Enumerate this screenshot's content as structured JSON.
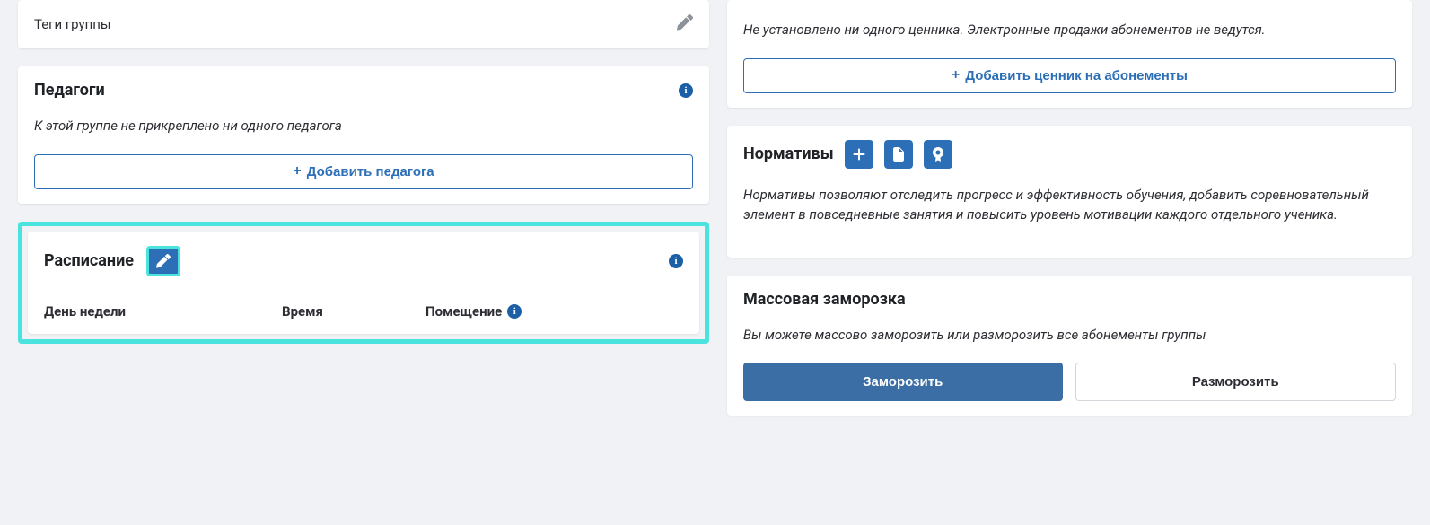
{
  "tags": {
    "label": "Теги группы"
  },
  "teachers": {
    "title": "Педагоги",
    "empty": "К этой группе не прикреплено ни одного педагога",
    "add_label": "Добавить педагога"
  },
  "schedule": {
    "title": "Расписание",
    "col_day": "День недели",
    "col_time": "Время",
    "col_room": "Помещение"
  },
  "pricing": {
    "empty": "Не установлено ни одного ценника. Электронные продажи абонементов не ведутся.",
    "add_label": "Добавить ценник на абонементы"
  },
  "norms": {
    "title": "Нормативы",
    "desc": "Нормативы позволяют отследить прогресс и эффективность обучения, добавить соревновательный элемент в повседневные занятия и повысить уровень мотивации каждого отдельного ученика."
  },
  "freeze": {
    "title": "Массовая заморозка",
    "desc": "Вы можете массово заморозить или разморозить все абонементы группы",
    "freeze_label": "Заморозить",
    "unfreeze_label": "Разморозить"
  }
}
